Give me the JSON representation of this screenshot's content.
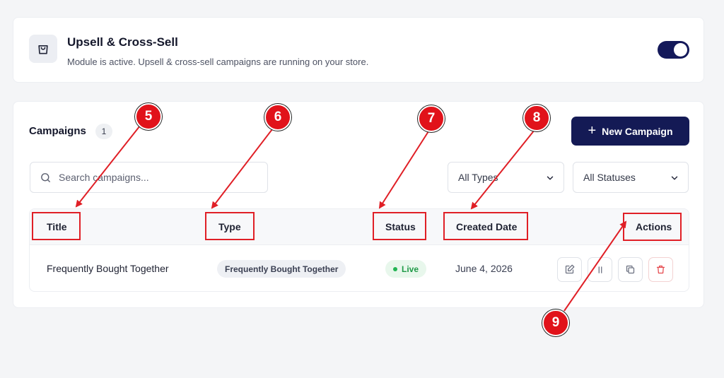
{
  "module": {
    "title": "Upsell & Cross-Sell",
    "description": "Module is active. Upsell & cross-sell campaigns are running on your store.",
    "icon": "shopping-bag-icon",
    "toggle_on": true
  },
  "campaigns": {
    "title": "Campaigns",
    "count": "1",
    "new_button_label": "New Campaign",
    "search_placeholder": "Search campaigns...",
    "type_filter": {
      "selected": "All Types"
    },
    "status_filter": {
      "selected": "All Statuses"
    },
    "columns": [
      "Title",
      "Type",
      "Status",
      "Created Date",
      "Actions"
    ],
    "rows": [
      {
        "title": "Frequently Bought Together",
        "type": "Frequently Bought Together",
        "status": "Live",
        "created": "June 4, 2026",
        "actions": [
          "edit-icon",
          "pause-icon",
          "duplicate-icon",
          "trash-icon"
        ]
      }
    ]
  },
  "annotations": {
    "markers": [
      "5",
      "6",
      "7",
      "8",
      "9"
    ]
  },
  "colors": {
    "primary": "#141a55",
    "live": "#1f9a47",
    "annotation": "#e01f26",
    "danger": "#e5484d"
  }
}
